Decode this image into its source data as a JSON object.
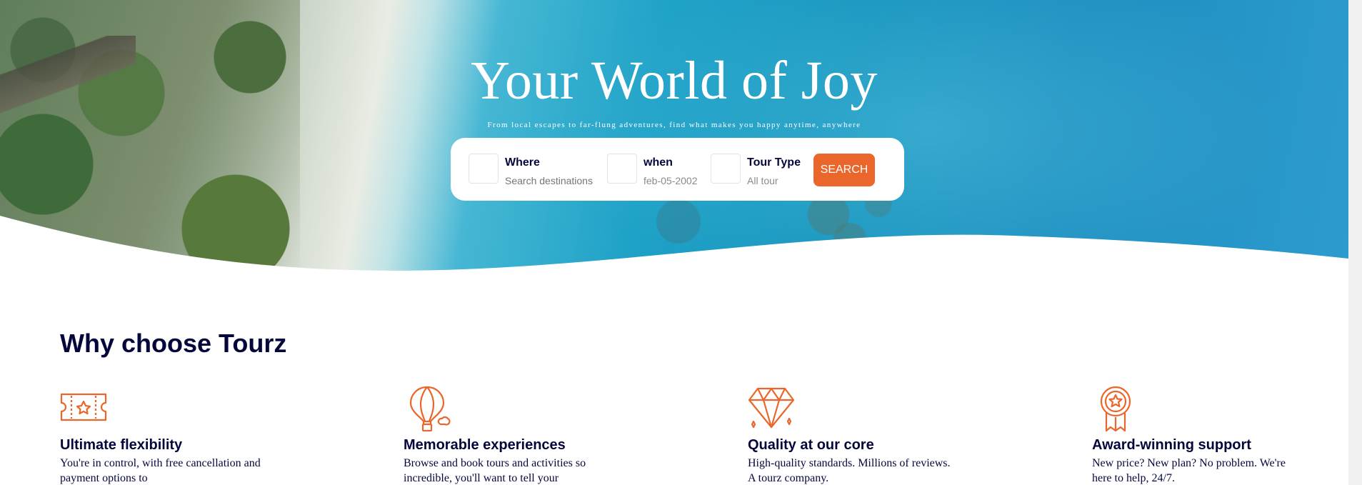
{
  "hero": {
    "title": "Your World of Joy",
    "subtitle": "From local escapes to far-flung adventures, find what makes you happy anytime, anywhere"
  },
  "search": {
    "where": {
      "label": "Where",
      "placeholder": "Search destinations"
    },
    "when": {
      "label": "when",
      "value": "feb-05-2002"
    },
    "tour_type": {
      "label": "Tour Type",
      "value": "All tour"
    },
    "button_label": "SEARCH"
  },
  "why": {
    "heading": "Why choose Tourz",
    "features": [
      {
        "icon": "ticket-icon",
        "title": "Ultimate flexibility",
        "text": "You're in control, with free cancellation and payment options to"
      },
      {
        "icon": "hot-air-balloon-icon",
        "title": "Memorable experiences",
        "text": "Browse and book tours and activities so incredible, you'll want to tell your"
      },
      {
        "icon": "diamond-icon",
        "title": "Quality at our core",
        "text": "High-quality standards. Millions of reviews. A tourz company."
      },
      {
        "icon": "award-icon",
        "title": "Award-winning support",
        "text": "New price? New plan? No problem. We're here to help, 24/7."
      }
    ]
  },
  "colors": {
    "accent": "#eb662b",
    "heading": "#05073c"
  }
}
